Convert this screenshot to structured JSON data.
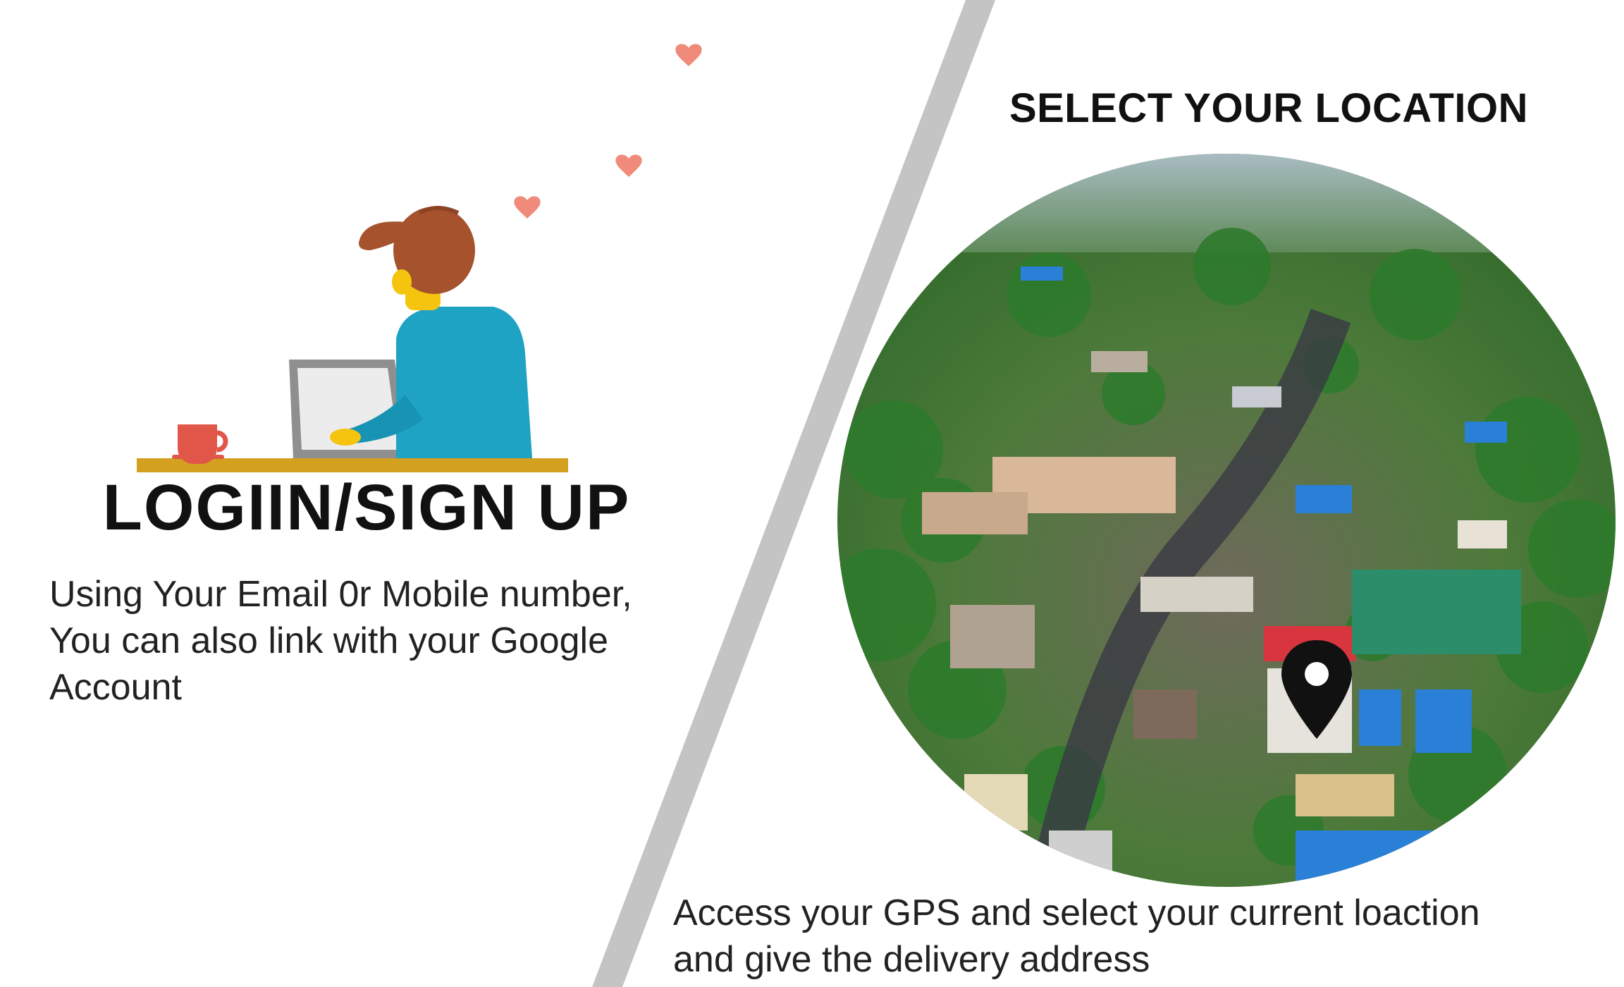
{
  "left_panel": {
    "title": "LOGIIN/SIGN UP",
    "description_line1": "Using Your Email 0r Mobile number,",
    "description_line2": "You can also link with your Google",
    "description_line3": "Account",
    "illustration_icon": "person-laptop-illustration"
  },
  "right_panel": {
    "title": "SELECT YOUR LOCATION",
    "description_line1": "Access your GPS and select your current loaction",
    "description_line2": "and give the delivery address",
    "map_icon": "location-pin-icon"
  },
  "colors": {
    "divider": "#c4c4c4",
    "heart": "#f08a7a",
    "desk": "#d4a020",
    "shirt": "#1ea3c4",
    "hair": "#a5522d",
    "skin": "#f5c40f",
    "mug": "#e0574a",
    "blue_roof": "#2a7fd6",
    "teal_roof": "#2b8d6a"
  }
}
